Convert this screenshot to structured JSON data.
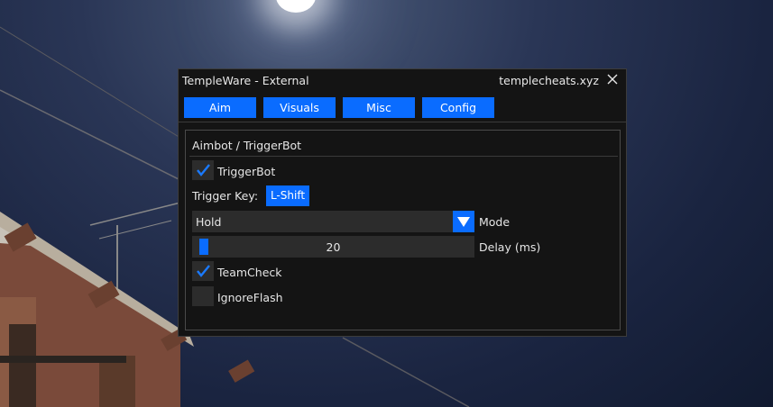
{
  "window": {
    "title": "TempleWare - External",
    "site": "templecheats.xyz"
  },
  "tabs": [
    {
      "label": "Aim"
    },
    {
      "label": "Visuals"
    },
    {
      "label": "Misc"
    },
    {
      "label": "Config"
    }
  ],
  "panel": {
    "title": "Aimbot / TriggerBot",
    "triggerbot": {
      "label": "TriggerBot",
      "checked": true
    },
    "trigger_key": {
      "label": "Trigger Key:",
      "value": "L-Shift"
    },
    "mode": {
      "value": "Hold",
      "label": "Mode"
    },
    "delay": {
      "value": "20",
      "label": "Delay (ms)"
    },
    "teamcheck": {
      "label": "TeamCheck",
      "checked": true
    },
    "ignoreflash": {
      "label": "IgnoreFlash",
      "checked": false
    }
  },
  "colors": {
    "accent": "#0a6cff",
    "window_bg": "#141414",
    "control_bg": "#2c2c2c"
  },
  "icons": [
    "close-icon",
    "check-icon",
    "dropdown-arrow-icon"
  ]
}
